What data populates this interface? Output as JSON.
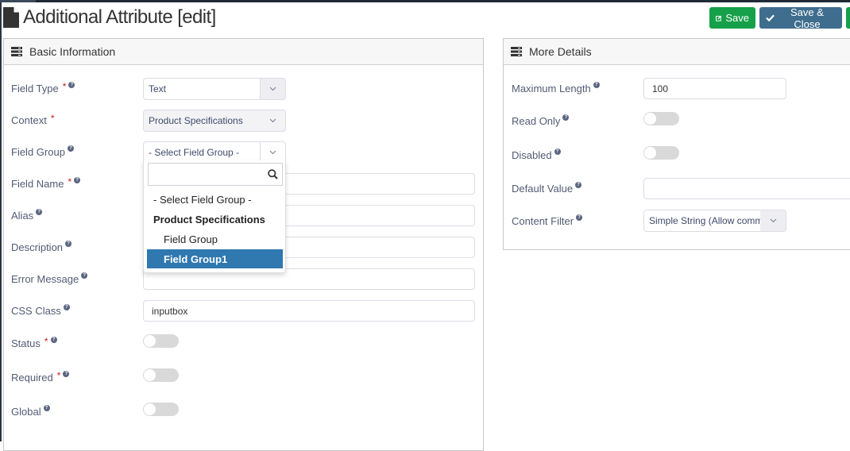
{
  "header": {
    "title": "Additional Attribute [edit]",
    "buttons": {
      "save": "Save",
      "save_close": "Save & Close"
    }
  },
  "basic_info": {
    "title": "Basic Information",
    "fields": {
      "field_type": {
        "label": "Field Type",
        "required": true,
        "value": "Text"
      },
      "context": {
        "label": "Context",
        "required": true,
        "value": "Product Specifications"
      },
      "field_group": {
        "label": "Field Group",
        "value": "- Select Field Group -"
      },
      "field_name": {
        "label": "Field Name",
        "required": true,
        "value": ""
      },
      "alias": {
        "label": "Alias",
        "value": ""
      },
      "description": {
        "label": "Description",
        "value": ""
      },
      "error_message": {
        "label": "Error Message",
        "value": ""
      },
      "css_class": {
        "label": "CSS Class",
        "value": "inputbox"
      },
      "status": {
        "label": "Status",
        "required": true,
        "on": false
      },
      "required": {
        "label": "Required",
        "required": true,
        "on": false
      },
      "global": {
        "label": "Global",
        "on": false
      }
    },
    "field_group_dropdown": {
      "search_value": "",
      "options": [
        {
          "label": "- Select Field Group -",
          "kind": "option"
        },
        {
          "label": "Product Specifications",
          "kind": "group"
        },
        {
          "label": "Field Group",
          "kind": "child"
        },
        {
          "label": "Field Group1",
          "kind": "child",
          "highlighted": true
        }
      ]
    }
  },
  "more_details": {
    "title": "More Details",
    "fields": {
      "max_length": {
        "label": "Maximum Length",
        "value": "100"
      },
      "read_only": {
        "label": "Read Only",
        "on": false
      },
      "disabled": {
        "label": "Disabled",
        "on": false
      },
      "default_value": {
        "label": "Default Value",
        "value": ""
      },
      "content_filter": {
        "label": "Content Filter",
        "value": "Simple String (Allow comm"
      }
    }
  },
  "colors": {
    "save": "#16a04a",
    "save_close": "#3e6d8e",
    "highlight": "#2f78b0",
    "required": "#c81a1a"
  }
}
